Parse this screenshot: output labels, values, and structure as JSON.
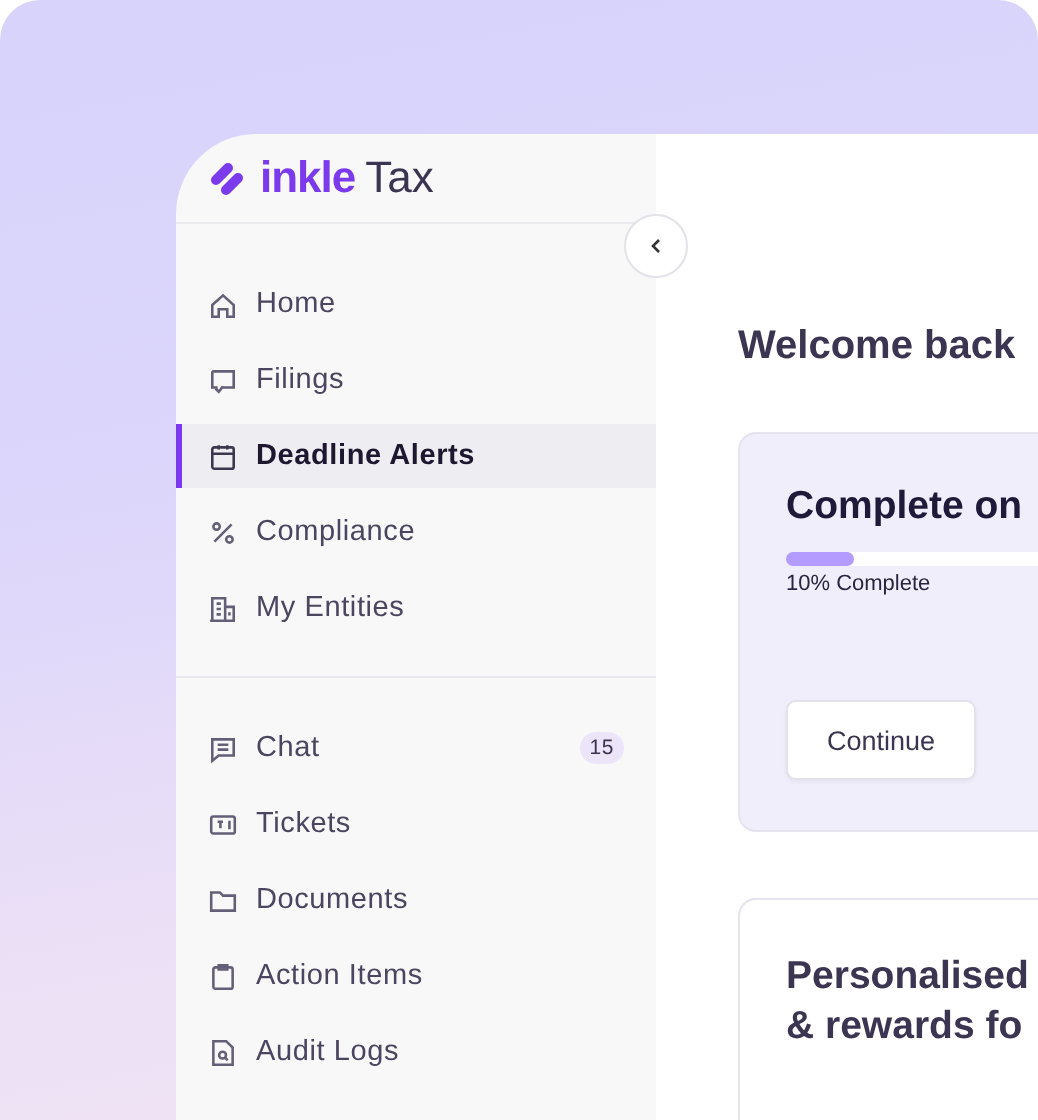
{
  "brand": {
    "name": "inkle",
    "product": "Tax"
  },
  "sidebar": {
    "sections": [
      {
        "items": [
          {
            "label": "Home",
            "kind": "home",
            "selected": false
          },
          {
            "label": "Filings",
            "kind": "filings",
            "selected": false
          },
          {
            "label": "Deadline Alerts",
            "kind": "calendar",
            "selected": true
          },
          {
            "label": "Compliance",
            "kind": "percent",
            "selected": false
          },
          {
            "label": "My Entities",
            "kind": "building",
            "selected": false
          }
        ]
      },
      {
        "items": [
          {
            "label": "Chat",
            "kind": "chat",
            "selected": false,
            "badge": "15"
          },
          {
            "label": "Tickets",
            "kind": "ticket",
            "selected": false
          },
          {
            "label": "Documents",
            "kind": "folder",
            "selected": false
          },
          {
            "label": "Action Items",
            "kind": "clipboard",
            "selected": false
          },
          {
            "label": "Audit Logs",
            "kind": "file",
            "selected": false
          }
        ]
      }
    ]
  },
  "main": {
    "greeting": "Welcome back",
    "cards": [
      {
        "kind": "progress",
        "title": [
          "Complete on"
        ],
        "level": 0.1,
        "progress_label": "10% Complete",
        "button": "Continue"
      },
      {
        "kind": "info",
        "title": [
          "Personalised",
          "& rewards fo"
        ]
      }
    ]
  }
}
